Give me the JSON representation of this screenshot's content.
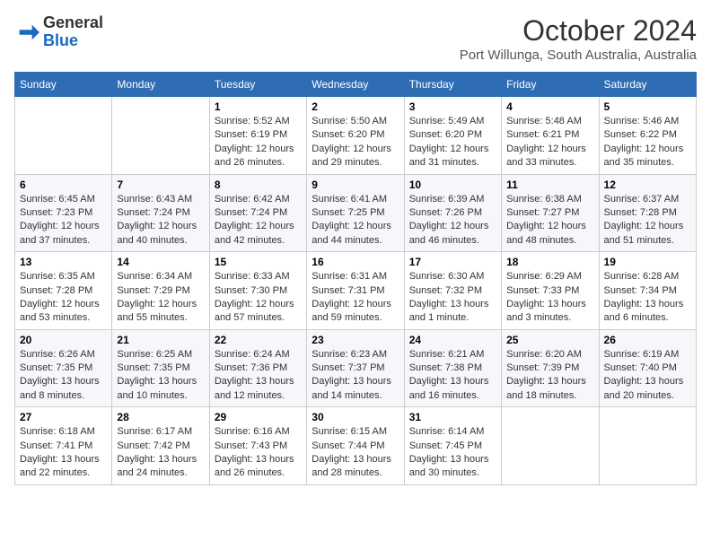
{
  "logo": {
    "general": "General",
    "blue": "Blue"
  },
  "title": "October 2024",
  "location": "Port Willunga, South Australia, Australia",
  "days_of_week": [
    "Sunday",
    "Monday",
    "Tuesday",
    "Wednesday",
    "Thursday",
    "Friday",
    "Saturday"
  ],
  "weeks": [
    [
      {
        "day": "",
        "info": ""
      },
      {
        "day": "",
        "info": ""
      },
      {
        "day": "1",
        "sunrise": "Sunrise: 5:52 AM",
        "sunset": "Sunset: 6:19 PM",
        "daylight": "Daylight: 12 hours and 26 minutes."
      },
      {
        "day": "2",
        "sunrise": "Sunrise: 5:50 AM",
        "sunset": "Sunset: 6:20 PM",
        "daylight": "Daylight: 12 hours and 29 minutes."
      },
      {
        "day": "3",
        "sunrise": "Sunrise: 5:49 AM",
        "sunset": "Sunset: 6:20 PM",
        "daylight": "Daylight: 12 hours and 31 minutes."
      },
      {
        "day": "4",
        "sunrise": "Sunrise: 5:48 AM",
        "sunset": "Sunset: 6:21 PM",
        "daylight": "Daylight: 12 hours and 33 minutes."
      },
      {
        "day": "5",
        "sunrise": "Sunrise: 5:46 AM",
        "sunset": "Sunset: 6:22 PM",
        "daylight": "Daylight: 12 hours and 35 minutes."
      }
    ],
    [
      {
        "day": "6",
        "sunrise": "Sunrise: 6:45 AM",
        "sunset": "Sunset: 7:23 PM",
        "daylight": "Daylight: 12 hours and 37 minutes."
      },
      {
        "day": "7",
        "sunrise": "Sunrise: 6:43 AM",
        "sunset": "Sunset: 7:24 PM",
        "daylight": "Daylight: 12 hours and 40 minutes."
      },
      {
        "day": "8",
        "sunrise": "Sunrise: 6:42 AM",
        "sunset": "Sunset: 7:24 PM",
        "daylight": "Daylight: 12 hours and 42 minutes."
      },
      {
        "day": "9",
        "sunrise": "Sunrise: 6:41 AM",
        "sunset": "Sunset: 7:25 PM",
        "daylight": "Daylight: 12 hours and 44 minutes."
      },
      {
        "day": "10",
        "sunrise": "Sunrise: 6:39 AM",
        "sunset": "Sunset: 7:26 PM",
        "daylight": "Daylight: 12 hours and 46 minutes."
      },
      {
        "day": "11",
        "sunrise": "Sunrise: 6:38 AM",
        "sunset": "Sunset: 7:27 PM",
        "daylight": "Daylight: 12 hours and 48 minutes."
      },
      {
        "day": "12",
        "sunrise": "Sunrise: 6:37 AM",
        "sunset": "Sunset: 7:28 PM",
        "daylight": "Daylight: 12 hours and 51 minutes."
      }
    ],
    [
      {
        "day": "13",
        "sunrise": "Sunrise: 6:35 AM",
        "sunset": "Sunset: 7:28 PM",
        "daylight": "Daylight: 12 hours and 53 minutes."
      },
      {
        "day": "14",
        "sunrise": "Sunrise: 6:34 AM",
        "sunset": "Sunset: 7:29 PM",
        "daylight": "Daylight: 12 hours and 55 minutes."
      },
      {
        "day": "15",
        "sunrise": "Sunrise: 6:33 AM",
        "sunset": "Sunset: 7:30 PM",
        "daylight": "Daylight: 12 hours and 57 minutes."
      },
      {
        "day": "16",
        "sunrise": "Sunrise: 6:31 AM",
        "sunset": "Sunset: 7:31 PM",
        "daylight": "Daylight: 12 hours and 59 minutes."
      },
      {
        "day": "17",
        "sunrise": "Sunrise: 6:30 AM",
        "sunset": "Sunset: 7:32 PM",
        "daylight": "Daylight: 13 hours and 1 minute."
      },
      {
        "day": "18",
        "sunrise": "Sunrise: 6:29 AM",
        "sunset": "Sunset: 7:33 PM",
        "daylight": "Daylight: 13 hours and 3 minutes."
      },
      {
        "day": "19",
        "sunrise": "Sunrise: 6:28 AM",
        "sunset": "Sunset: 7:34 PM",
        "daylight": "Daylight: 13 hours and 6 minutes."
      }
    ],
    [
      {
        "day": "20",
        "sunrise": "Sunrise: 6:26 AM",
        "sunset": "Sunset: 7:35 PM",
        "daylight": "Daylight: 13 hours and 8 minutes."
      },
      {
        "day": "21",
        "sunrise": "Sunrise: 6:25 AM",
        "sunset": "Sunset: 7:35 PM",
        "daylight": "Daylight: 13 hours and 10 minutes."
      },
      {
        "day": "22",
        "sunrise": "Sunrise: 6:24 AM",
        "sunset": "Sunset: 7:36 PM",
        "daylight": "Daylight: 13 hours and 12 minutes."
      },
      {
        "day": "23",
        "sunrise": "Sunrise: 6:23 AM",
        "sunset": "Sunset: 7:37 PM",
        "daylight": "Daylight: 13 hours and 14 minutes."
      },
      {
        "day": "24",
        "sunrise": "Sunrise: 6:21 AM",
        "sunset": "Sunset: 7:38 PM",
        "daylight": "Daylight: 13 hours and 16 minutes."
      },
      {
        "day": "25",
        "sunrise": "Sunrise: 6:20 AM",
        "sunset": "Sunset: 7:39 PM",
        "daylight": "Daylight: 13 hours and 18 minutes."
      },
      {
        "day": "26",
        "sunrise": "Sunrise: 6:19 AM",
        "sunset": "Sunset: 7:40 PM",
        "daylight": "Daylight: 13 hours and 20 minutes."
      }
    ],
    [
      {
        "day": "27",
        "sunrise": "Sunrise: 6:18 AM",
        "sunset": "Sunset: 7:41 PM",
        "daylight": "Daylight: 13 hours and 22 minutes."
      },
      {
        "day": "28",
        "sunrise": "Sunrise: 6:17 AM",
        "sunset": "Sunset: 7:42 PM",
        "daylight": "Daylight: 13 hours and 24 minutes."
      },
      {
        "day": "29",
        "sunrise": "Sunrise: 6:16 AM",
        "sunset": "Sunset: 7:43 PM",
        "daylight": "Daylight: 13 hours and 26 minutes."
      },
      {
        "day": "30",
        "sunrise": "Sunrise: 6:15 AM",
        "sunset": "Sunset: 7:44 PM",
        "daylight": "Daylight: 13 hours and 28 minutes."
      },
      {
        "day": "31",
        "sunrise": "Sunrise: 6:14 AM",
        "sunset": "Sunset: 7:45 PM",
        "daylight": "Daylight: 13 hours and 30 minutes."
      },
      {
        "day": "",
        "info": ""
      },
      {
        "day": "",
        "info": ""
      }
    ]
  ]
}
